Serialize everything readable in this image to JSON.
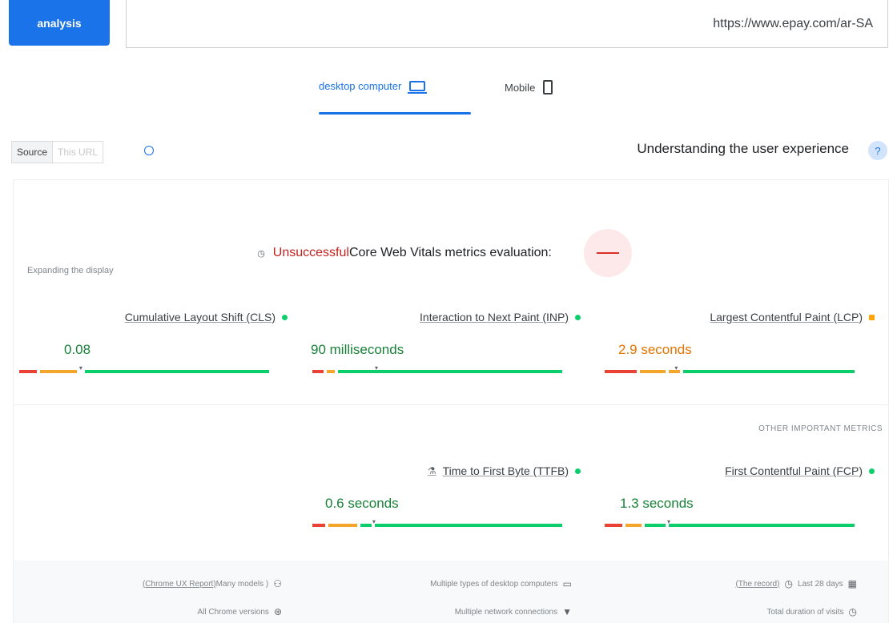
{
  "toolbar": {
    "analyze_label": "analysis",
    "url_value": "https://www.epay.com/ar-SA"
  },
  "device_tabs": [
    {
      "label": "desktop computer",
      "active": true
    },
    {
      "label": "Mobile",
      "active": false
    }
  ],
  "source_toggle": {
    "on": "Source",
    "off": "This URL"
  },
  "ux_section": {
    "title": "Understanding the user experience"
  },
  "assessment": {
    "status": "Unsuccessful",
    "text": "Core Web Vitals metrics evaluation:"
  },
  "expand_label": "Expanding the display",
  "metrics": [
    {
      "name": "Cumulative Layout Shift (CLS)",
      "value": "0.08",
      "status": "good",
      "marker_pct": 24
    },
    {
      "name": "Interaction to Next Paint (INP)",
      "value": "90 milliseconds",
      "status": "good",
      "marker_pct": 25
    },
    {
      "name": "Largest Contentful Paint (LCP)",
      "value": "2.9 seconds",
      "status": "needs-improvement",
      "marker_pct": 28
    }
  ],
  "other_metrics_label": "OTHER IMPORTANT METRICS",
  "other_metrics": [
    {
      "name": "Time to First Byte (TTFB)",
      "value": "0.6 seconds",
      "status": "good",
      "marker_pct": 24
    },
    {
      "name": "First Contentful Paint (FCP)",
      "value": "1.3 seconds",
      "status": "good",
      "marker_pct": 25
    }
  ],
  "footer": {
    "crux_link": "(Chrome UX Report)",
    "crux_text": "Many models )",
    "devices": "Multiple types of desktop computers",
    "record_link": "(The record)",
    "period": "Last 28 days",
    "chrome_versions": "All Chrome versions",
    "connections": "Multiple network connections",
    "duration": "Total duration of visits"
  },
  "colors": {
    "accent": "#1a73e8",
    "good": "#0cce6b",
    "average": "#ffa400",
    "poor": "#ea4335"
  }
}
